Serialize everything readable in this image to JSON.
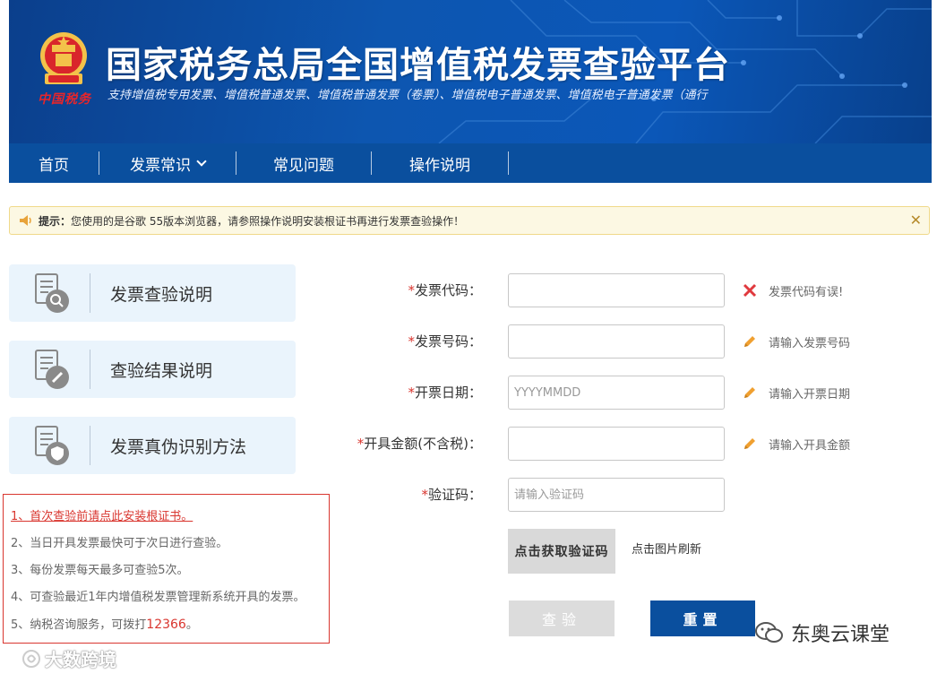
{
  "header": {
    "emblem_caption": "中国税务",
    "title": "国家税务总局全国增值税发票查验平台",
    "subtitle": "支持增值税专用发票、增值税普通发票、增值税普通发票（卷票）、增值税电子普通发票、增值税电子普通发票（通行"
  },
  "nav": {
    "items": [
      {
        "label": "首页"
      },
      {
        "label": "发票常识"
      },
      {
        "label": "常见问题"
      },
      {
        "label": "操作说明"
      }
    ]
  },
  "notice": {
    "label": "提示：",
    "text": "您使用的是谷歌 55版本浏览器，请参照操作说明安装根证书再进行发票查验操作！",
    "close": "✕"
  },
  "cards": [
    {
      "label": "发票查验说明"
    },
    {
      "label": "查验结果说明"
    },
    {
      "label": "发票真伪识别方法"
    }
  ],
  "tips": {
    "t1": "1、首次查验前请点此安装根证书。",
    "t2": "2、当日开具发票最快可于次日进行查验。",
    "t3": "3、每份发票每天最多可查验5次。",
    "t4": "4、可查验最近1年内增值税发票管理新系统开具的发票。",
    "t5_prefix": "5、纳税咨询服务，可拨打",
    "t5_phone": "12366",
    "t5_suffix": "。"
  },
  "form": {
    "code": {
      "star": "*",
      "label": "发票代码：",
      "value": "",
      "placeholder": "",
      "status": "发票代码有误!"
    },
    "number": {
      "star": "*",
      "label": "发票号码：",
      "value": "",
      "placeholder": "",
      "status": "请输入发票号码"
    },
    "date": {
      "star": "*",
      "label": "开票日期：",
      "value": "",
      "placeholder": "YYYYMMDD",
      "status": "请输入开票日期"
    },
    "amount": {
      "star": "*",
      "label": "开具金额(不含税)：",
      "value": "",
      "placeholder": "",
      "status": "请输入开具金额"
    },
    "captcha": {
      "star": "*",
      "label": "验证码：",
      "value": "",
      "placeholder": "请输入验证码"
    }
  },
  "captcha_image_text": "点击获取验证码",
  "captcha_refresh": "点击图片刷新",
  "buttons": {
    "query": "查验",
    "reset": "重置"
  },
  "watermarks": {
    "wechat": "东奥云课堂",
    "corner": "大数跨境"
  },
  "colors": {
    "brand_blue": "#0a4f9e",
    "error_red": "#d9362f",
    "notice_bg": "#fcf8e3",
    "card_bg": "#eaf4fc"
  }
}
